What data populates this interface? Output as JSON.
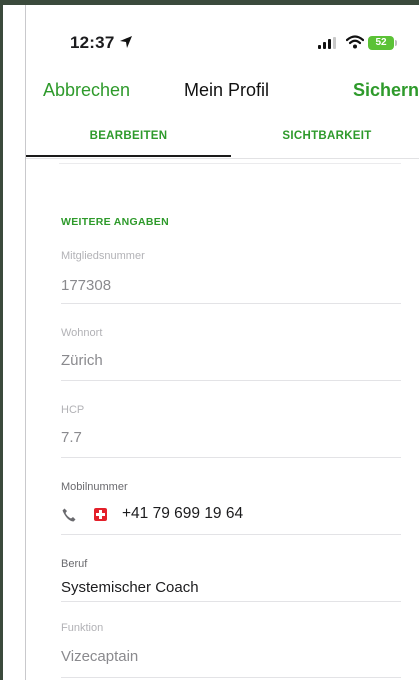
{
  "status_bar": {
    "time": "12:37",
    "battery": "52"
  },
  "nav": {
    "cancel": "Abbrechen",
    "title": "Mein Profil",
    "save": "Sichern"
  },
  "tabs": [
    {
      "label": "BEARBEITEN",
      "active": true
    },
    {
      "label": "SICHTBARKEIT",
      "active": false
    }
  ],
  "section": {
    "header": "WEITERE ANGABEN"
  },
  "fields": {
    "member_number": {
      "label": "Mitgliedsnummer",
      "value": "177308",
      "editable": false
    },
    "residence": {
      "label": "Wohnort",
      "value": "Zürich",
      "editable": false
    },
    "hcp": {
      "label": "HCP",
      "value": "7.7",
      "editable": false
    },
    "mobile": {
      "label": "Mobilnummer",
      "value": "+41 79 699 19 64",
      "editable": true
    },
    "profession": {
      "label": "Beruf",
      "value": "Systemischer Coach",
      "editable": true
    },
    "function": {
      "label": "Funktion",
      "value": "Vizecaptain",
      "editable": false
    }
  },
  "icons": {
    "location": "location-arrow-icon",
    "signal": "cellular-signal-icon",
    "wifi": "wifi-icon",
    "phone": "phone-icon",
    "flag": "swiss-flag-icon"
  },
  "colors": {
    "accent": "#2e9a2b",
    "battery": "#5bc236"
  }
}
